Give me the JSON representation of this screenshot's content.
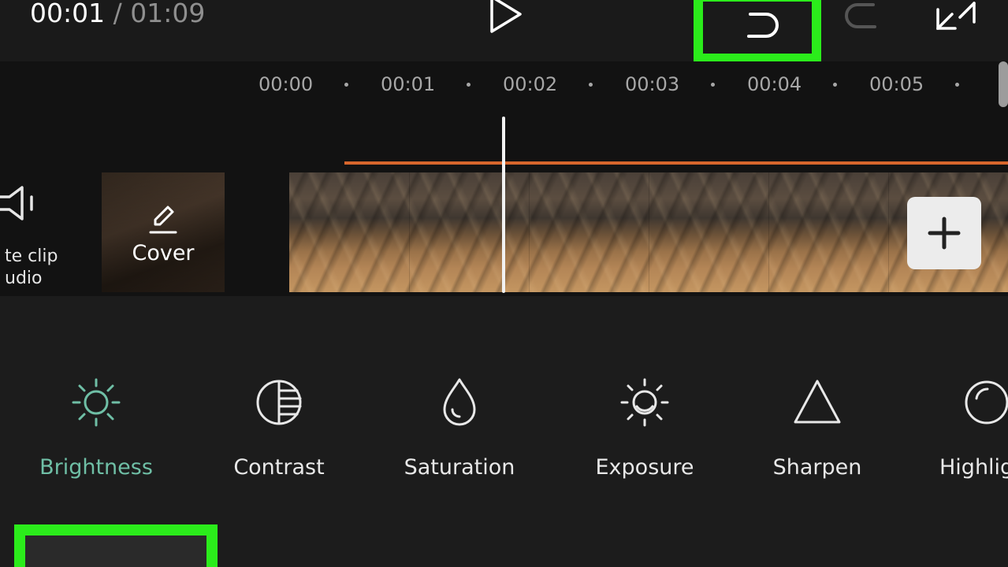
{
  "player": {
    "current_time": "00:01",
    "separator": " / ",
    "total_time": "01:09"
  },
  "ruler": {
    "ticks": [
      "00:00",
      "00:01",
      "00:02",
      "00:03",
      "00:04",
      "00:05"
    ]
  },
  "tracks": {
    "mute_label_line1": "te clip",
    "mute_label_line2": "udio",
    "cover_label": "Cover"
  },
  "tools": [
    {
      "label": "Brightness",
      "icon": "sun-icon",
      "active": true
    },
    {
      "label": "Contrast",
      "icon": "contrast-icon",
      "active": false
    },
    {
      "label": "Saturation",
      "icon": "drop-icon",
      "active": false
    },
    {
      "label": "Exposure",
      "icon": "exposure-icon",
      "active": false
    },
    {
      "label": "Sharpen",
      "icon": "triangle-icon",
      "active": false
    },
    {
      "label": "Highlig",
      "icon": "highlight-icon",
      "active": false
    }
  ],
  "colors": {
    "highlight_box": "#2bec1b",
    "active_tool": "#6fbfa6",
    "orange_track_line": "#d7662c"
  }
}
